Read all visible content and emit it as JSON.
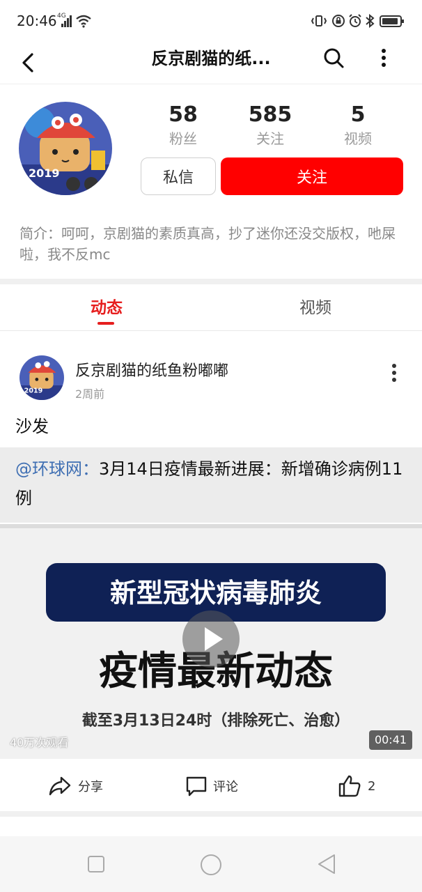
{
  "status_bar": {
    "time": "20:46",
    "network": "4G"
  },
  "header": {
    "title": "反京剧猫的纸..."
  },
  "profile": {
    "stats": [
      {
        "value": "58",
        "label": "粉丝"
      },
      {
        "value": "585",
        "label": "关注"
      },
      {
        "value": "5",
        "label": "视频"
      }
    ],
    "message_label": "私信",
    "follow_label": "关注",
    "bio": "简介：呵呵，京剧猫的素质真高，抄了迷你还没交版权，吔屎啦，我不反mc"
  },
  "tabs": [
    {
      "label": "动态",
      "active": true
    },
    {
      "label": "视频",
      "active": false
    }
  ],
  "post": {
    "author": "反京剧猫的纸鱼粉嘟嘟",
    "time": "2周前",
    "text": "沙发",
    "quote": {
      "mention": "@环球网：",
      "text": "3月14日疫情最新进展：新增确诊病例11例"
    },
    "video": {
      "line1": "新型冠状病毒肺炎",
      "line2": "疫情最新动态",
      "line3": "截至3月13日24时（排除死亡、治愈）",
      "views": "40万次观看",
      "duration": "00:41"
    },
    "actions": {
      "share": "分享",
      "comment": "评论",
      "like_count": "2"
    }
  },
  "colors": {
    "accent": "#ff0000",
    "link": "#3f6fb3",
    "banner": "#0f2155"
  }
}
